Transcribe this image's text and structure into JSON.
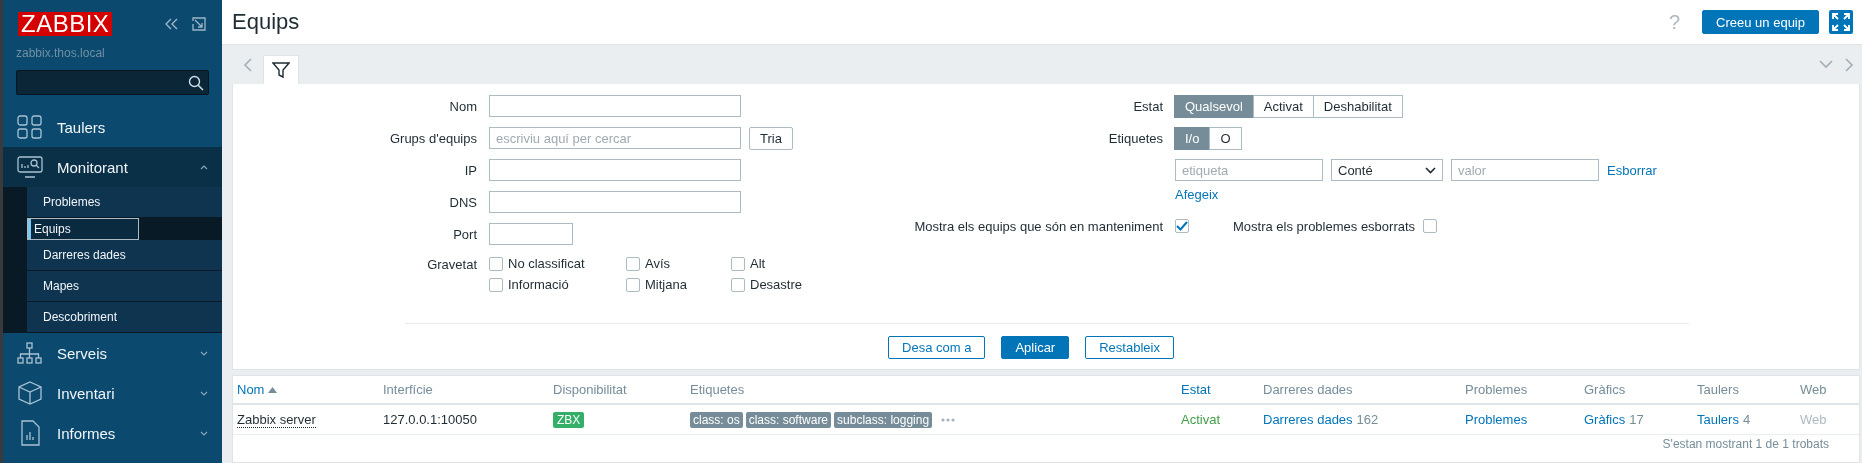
{
  "sidebar": {
    "logo": "ZABBIX",
    "server": "zabbix.thos.local",
    "items": [
      {
        "label": "Taulers"
      },
      {
        "label": "Monitorant",
        "expanded": true,
        "children": [
          {
            "label": "Problemes",
            "selected": false
          },
          {
            "label": "Equips",
            "selected": true
          },
          {
            "label": "Darreres dades",
            "selected": false
          },
          {
            "label": "Mapes",
            "selected": false
          },
          {
            "label": "Descobriment",
            "selected": false
          }
        ]
      },
      {
        "label": "Serveis",
        "expanded": false
      },
      {
        "label": "Inventari",
        "expanded": false
      },
      {
        "label": "Informes",
        "expanded": false
      }
    ]
  },
  "header": {
    "title": "Equips",
    "help": "?",
    "create_button": "Creeu un equip"
  },
  "filter": {
    "left": [
      {
        "label": "Nom",
        "kind": "text"
      },
      {
        "label": "Grups d'equips",
        "kind": "multiselect",
        "placeholder": "escriviu aquí per cercar",
        "button": "Tria"
      },
      {
        "label": "IP",
        "kind": "text"
      },
      {
        "label": "DNS",
        "kind": "text"
      },
      {
        "label": "Port",
        "kind": "short"
      }
    ],
    "severity": {
      "label": "Gravetat",
      "options": [
        {
          "label": "No classificat",
          "checked": false
        },
        {
          "label": "Avís",
          "checked": false
        },
        {
          "label": "Alt",
          "checked": false
        },
        {
          "label": "Informació",
          "checked": false
        },
        {
          "label": "Mitjana",
          "checked": false
        },
        {
          "label": "Desastre",
          "checked": false
        }
      ]
    },
    "status": {
      "label": "Estat",
      "options": [
        {
          "label": "Qualsevol",
          "selected": true
        },
        {
          "label": "Activat",
          "selected": false
        },
        {
          "label": "Deshabilitat",
          "selected": false
        }
      ]
    },
    "tags": {
      "label": "Etiquetes",
      "modes": [
        {
          "label": "I/o",
          "selected": true
        },
        {
          "label": "O",
          "selected": false
        }
      ],
      "rows": [
        {
          "tag_placeholder": "etiqueta",
          "operator": "Conté",
          "value_placeholder": "valor",
          "remove": "Esborrar"
        }
      ],
      "add": "Afegeix"
    },
    "options": [
      {
        "label": "Mostra els equips que són en manteniment",
        "checked": true
      },
      {
        "label": "Mostra els problemes esborrats",
        "checked": false
      }
    ],
    "buttons": [
      {
        "label": "Desa com a",
        "kind": "outline"
      },
      {
        "label": "Aplicar",
        "kind": "primary"
      },
      {
        "label": "Restableix",
        "kind": "outline"
      }
    ]
  },
  "table": {
    "columns": [
      {
        "label": "Nom",
        "sortable": true,
        "sorted": true
      },
      {
        "label": "Interfície",
        "sortable": false,
        "sorted": false
      },
      {
        "label": "Disponibilitat",
        "sortable": false,
        "sorted": false
      },
      {
        "label": "Etiquetes",
        "sortable": false,
        "sorted": false
      },
      {
        "label": "Estat",
        "sortable": true,
        "sorted": false
      },
      {
        "label": "Darreres dades",
        "sortable": false,
        "sorted": false
      },
      {
        "label": "Problemes",
        "sortable": false,
        "sorted": false
      },
      {
        "label": "Gràfics",
        "sortable": false,
        "sorted": false
      },
      {
        "label": "Taulers",
        "sortable": false,
        "sorted": false
      },
      {
        "label": "Web",
        "sortable": false,
        "sorted": false
      }
    ],
    "rows": [
      {
        "name": "Zabbix server",
        "interface": "127.0.0.1:10050",
        "availability": "ZBX",
        "tags": [
          "class: os",
          "class: software",
          "subclass: logging"
        ],
        "status": "Activat",
        "enabled": true,
        "latest_data": {
          "label": "Darreres dades",
          "count": "162"
        },
        "problems": "Problemes",
        "graphs": {
          "label": "Gràfics",
          "count": "17"
        },
        "dashboards": {
          "label": "Taulers",
          "count": "4"
        },
        "web": {
          "label": "Web",
          "disabled": true
        }
      }
    ],
    "footer": "S'estan mostrant 1 de 1 trobats"
  }
}
